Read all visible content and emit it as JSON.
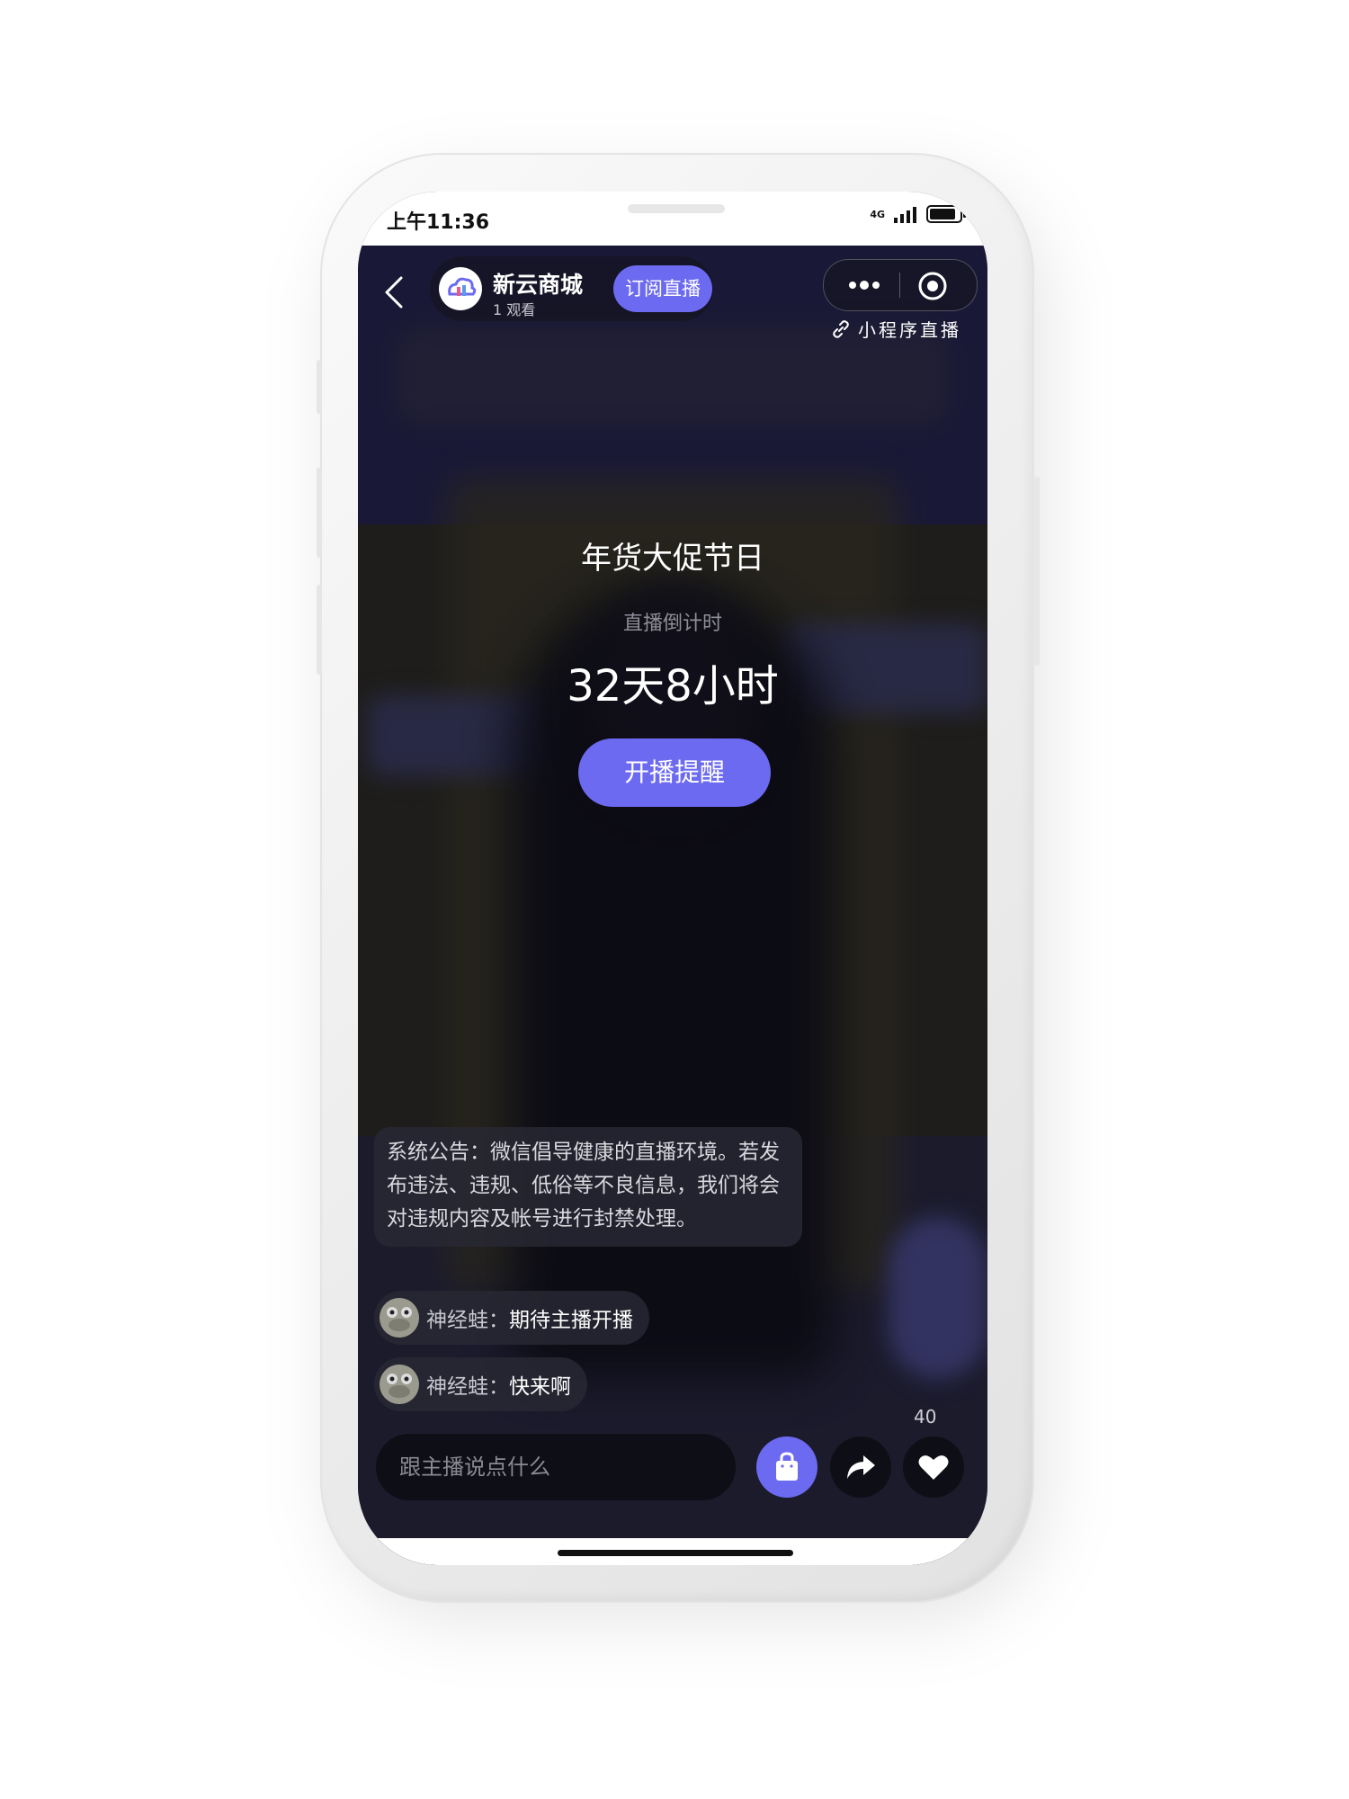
{
  "status_bar": {
    "time": "上午11:36",
    "network": "4G"
  },
  "header": {
    "shop_name": "新云商城",
    "viewers": "1 观看",
    "subscribe_label": "订阅直播",
    "mini_program_live": "小程序直播"
  },
  "event": {
    "title": "年货大促节日",
    "countdown_label": "直播倒计时",
    "countdown_value": "32天8小时",
    "remind_label": "开播提醒"
  },
  "notice": {
    "text": "系统公告：微信倡导健康的直播环境。若发布违法、违规、低俗等不良信息，我们将会对违规内容及帐号进行封禁处理。"
  },
  "comments": [
    {
      "user": "神经蛙：",
      "text": "期待主播开播"
    },
    {
      "user": "神经蛙：",
      "text": "快来啊"
    }
  ],
  "bottom_bar": {
    "like_count": "40",
    "input_placeholder": "跟主播说点什么"
  },
  "colors": {
    "accent": "#6c6af0",
    "background": "#1b1a30"
  },
  "icons": {
    "back": "chevron-left-icon",
    "more": "more-dots-icon",
    "record": "record-circle-icon",
    "link": "link-icon",
    "bag": "shopping-bag-icon",
    "share": "share-arrow-icon",
    "like": "heart-icon"
  }
}
